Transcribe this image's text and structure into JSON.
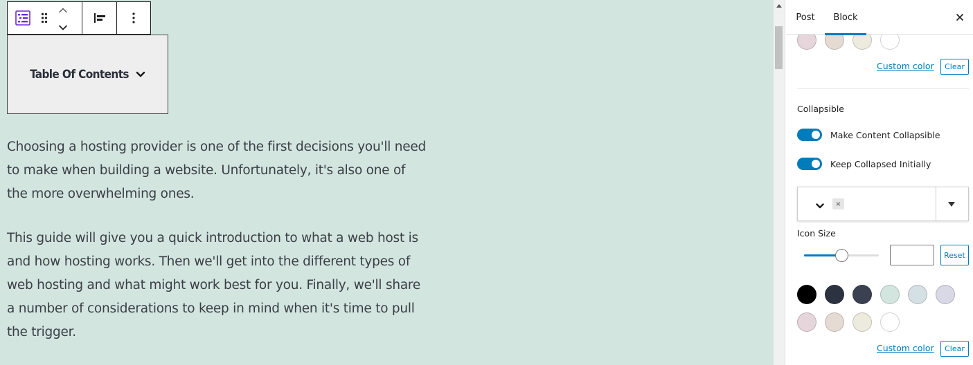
{
  "editor": {
    "toc_block": {
      "title": "Table Of Contents"
    },
    "paragraphs": [
      "Choosing a hosting provider is one of the first decisions you'll need to make when building a website. Unfortunately, it's also one of the more overwhelming ones.",
      "This guide will give you a quick introduction to what a web host is and how hosting works. Then we'll get into the different types of web hosting and what might work best for you. Finally, we'll share a number of considerations to keep in mind when it's time to pull the trigger."
    ],
    "background_color": "#d3e5df"
  },
  "toolbar": {
    "icons": [
      "table-of-contents-icon",
      "drag-handle-icon",
      "chevron-up-icon",
      "chevron-down-icon",
      "align-left-icon",
      "more-options-icon"
    ]
  },
  "sidebar": {
    "tabs": [
      {
        "label": "Post",
        "active": false
      },
      {
        "label": "Block",
        "active": true
      }
    ],
    "top_palette": {
      "colors": [
        "#e6d5da",
        "#e5dbd3",
        "#edebdd",
        "#ffffff"
      ],
      "custom_color_label": "Custom color",
      "clear_label": "Clear"
    },
    "collapsible": {
      "section_title": "Collapsible",
      "make_collapsible_label": "Make Content Collapsible",
      "make_collapsible_on": true,
      "keep_collapsed_label": "Keep Collapsed Initially",
      "keep_collapsed_on": true,
      "icon_remove_label": "×",
      "icon_size_label": "Icon Size",
      "icon_size_slider_fraction": 0.5,
      "icon_size_value": "",
      "reset_label": "Reset"
    },
    "bottom_palette": {
      "colors": [
        "#000000",
        "#2c3240",
        "#3b4150",
        "#d3e5df",
        "#d4e0e4",
        "#d8d8e6",
        "#e6d5da",
        "#e5dbd3",
        "#edebdd",
        "#ffffff"
      ],
      "custom_color_label": "Custom color",
      "clear_label": "Clear"
    },
    "accent_color": "#007cba"
  }
}
